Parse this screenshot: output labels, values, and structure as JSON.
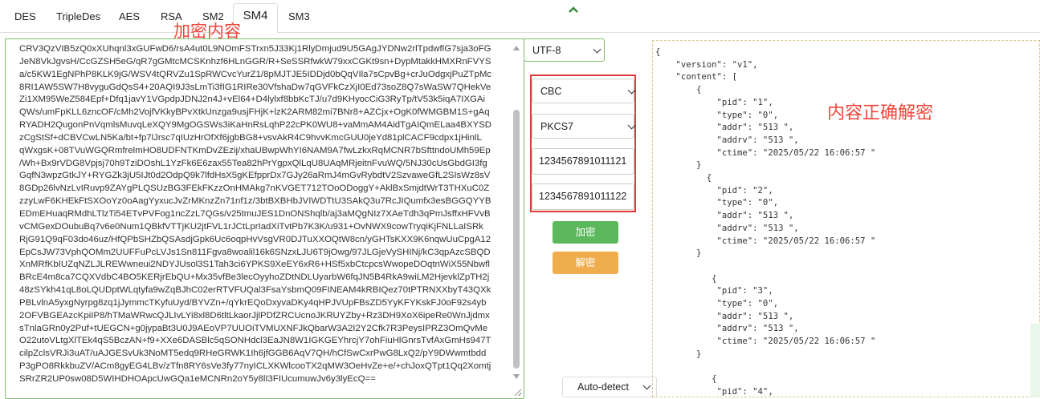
{
  "tabs": [
    {
      "label": "DES",
      "active": false
    },
    {
      "label": "TripleDes",
      "active": false
    },
    {
      "label": "AES",
      "active": false
    },
    {
      "label": "RSA",
      "active": false
    },
    {
      "label": "SM2",
      "active": false
    },
    {
      "label": "SM4",
      "active": true
    },
    {
      "label": "SM3",
      "active": false
    }
  ],
  "annotations": {
    "input_note": "加密内容",
    "output_note": "内容正确解密",
    "color": "#f2463a"
  },
  "ciphertext": [
    "CRV3QzVIB5zQ0xXUhqnl3xGUFwD6/rsA4ut0L9NOmFSTrxn5J33Kj1RlyDmjud9U5GAgJYDNw2rlTpdwflG7sja3oFG",
    "JeN8VkJgvsH/CcGZSH5eG/qR7gGMtcMCSKnhzf6HLnGGR/R+SeSSRfwkW79xxCGKt9sn+DypMtakkHMXRnFVYS",
    "a/c5KW1EgNPhP8KLK9jG/WSV4tQRVZu1SpRWCvcYurZ1/8pMJTJE5IDDjd0bQqVIla7sCpvBg+crJuOdgxjPuZTpMc",
    "8RI1AW5SW7H8vyguGdQsS4+20AQI9J3sLmTi3fIG1RIRe30VfshaDw7qGVFkCzXjI0Ed73soZ8Q7sWaSW7QHekVe",
    "Zi1XM95WeZ584Epf+Dfq1javY1VGpdpJDNJ2n4J+vEl64+D4lylxf8bbKcTJ/u7d9KHyocCiG3RyTp/tV53k5iqA7IXGAi",
    "QWs/umFpKLL6zncOF/cMh2VojfVKkyBPvXtkUnzga9usjFHjK+lzK2ARM82mi7BNr8+AZCjx+OgK0fWMGBM1S+gAq",
    "RYADH2QugonPnVqmlsMuvqLeXQY9MgOGSWs3iKaHnRsLqhP22cPK0WU8+vaMmAM4AidTgAIQmELaa4BXYSD",
    "zCgStSf+dCBVCwLN5Ka/bt+fp7lJrsc7qIUzHrOfXf6jgbBG8+vsvAkR4C9hvvKmcGUU0jeYd81plCACF9cdpx1jHinlL",
    "qWxgsK+08TVuWGQRmfrelmHO8UDFNTKmDvZEzij/xhaUBwpWhYI6NAM9A7fwLzkxRqMCNR7bSfttndoUMh59Ep",
    "/Wh+Bx9rVDG8Vpjsj70h9TziDOshL1YzFk6E6zax55Tea82hPrYgpxQlLqU8UAqMRjeitnFvuWQ/5NJ30cUsGbdGI3fg",
    "GqfN3wpzGtkJY+RYGZk3jU5IJt0d2OdpQ9k7lfdHsX5gKEfpprDx7GJy26aRmJ4mGvRybdtV2SzvaweGfL2SIsWz8sV",
    "8GDp26lvNzLvIRuvp9ZAYgPLQSUzBG3FEkFKzzOnHMAkg7nKVGET712TOoODoggY+AklBxSmjdtWrT3THXuC0Z",
    "zzyLwF6KHEkFtSXOoYz0oAagYyxucJvZrMKnzZn71nf1z/3btBXBHbJVIWDTtU3SAkQ3u7RcJIQumfx3esBGGQYYB",
    "EDmEHuaqRMdhLTlzTi54ETvPVFog1ncZzL7QGs/v25tmuJES1DnONShqlb/aj3aMQgNIz7XAeTdh3qPmJsffxHFVvB",
    "vCMGexDOubuBq7v6e0Num1QBkfVTTjKU2jtFVL1rJCtLprIadXiTvtPb7K3K/u931+OvNWX9cowTryqiKjFNLLaISRk",
    "RjG91Q9qF03do46uz/HfQPbSHZbQSAsdjGpk6Uc6oqpHvVsgVR0DJTuXXOQtW8cn/yGHTsKXX9K6nqwUuCpgA12",
    "EpCsJW73VphQOMm2UUFFuPcLVJs1Sn811Fgva8woalil16k6SNzxLJU6T9jOwg/97JLGjeVySHINj/kC3qpAzcSBQD",
    "XnMRfKbIUZqNZLJLREWwneui2NDYJUsol3S1Tah3ci6YPKS9XeEY6xR6+HSf5xbCtcpcsWwopeDOqtnWiX55Nbwfl",
    "BRcE4m8ca7CQXVdbC4BO5KERjrEbQU+Mx35vfBe3lecOyyhoZDtNDLUyarbW6fqJN5B4RkA9wiLM2HjevklZpTH2j",
    "48zSYkh41qL8oLQUDptWLqtyfa9wZqBJhC02erRTVFUQal3FsaYsbmQ09FINEAM4kRBIQez70tPTRNXXbyT43QXk",
    "PBLvlnA5yxgNyrpg8zq1jJymmcTKyfuUyd/BYVZn+/qYkrEQoDxyvaDKy4qHPJVUpFBsZD5YyKFYKskFJ0oF92s4yb",
    "2OFVBGEAzcKpiIP8/hTMaWRwcQJLIvLYi8xl8D6tltLkaorJjlPDfZRCUcnoJKRUYZby+Rz3DH9XoX6ipeRe0WnJjdmx",
    "sTnlaGRn0y2Puf+tUEGCN+g0jypaBt3U0J9AEoVP7UUOiTVMUXNFJkQbarW3A2I2Y2Cfk7R3PeysIPRZ3OmQvMe",
    "O22utoVLtgXlTEk4qS5BczAN+f9+XXe6DASBlc5qSONHdcl3EaJN8W1IGKGEYhrcjY7ohFiuHlGnrsTvfAxGmHs947T",
    "cilpZclsVRJi3uAT/uAJGESvUk3NoMT5edq9RHeGRWK1Ih6jfGGB6AqV7QH/hCfSwCxrPwG8LxQ2/pY9DWwmtbdd",
    "P3gPO8RkkbuZV/ACm8gyEG4LBv/zTfn8RY6sVe3fy77nyICLXKWlcooTX2qMW3OeHvZe+e/+chJoxQTpt1Qq2Xomtj",
    "SRrZR2UP0sw08D5WIHDHOApcUwGQa1eMCNRn2oY5y8lI3FIUcumuwJv6y3lyEcQ=="
  ],
  "encoding": {
    "selected": "UTF-8"
  },
  "mode": {
    "selected": "CBC"
  },
  "padding": {
    "selected": "PKCS7"
  },
  "key": {
    "value": "1234567891011121"
  },
  "iv": {
    "value": "1234567891011122"
  },
  "buttons": {
    "encrypt": "加密",
    "decrypt": "解密"
  },
  "detect": {
    "selected": "Auto-detect"
  },
  "output_lines": [
    "{",
    "    \"version\": \"v1\",",
    "    \"content\": [",
    "        {",
    "            \"pid\": \"1\",",
    "            \"type\": \"0\",",
    "            \"addr\": \"513 \",",
    "            \"addrv\": \"513 \",",
    "            \"ctime\": \"2025/05/22 16:06:57 \"",
    "        }",
    "          {",
    "            \"pid\": \"2\",",
    "            \"type\": \"0\",",
    "            \"addr\": \"513 \",",
    "            \"addrv\": \"513 \",",
    "            \"ctime\": \"2025/05/22 16:06:57 \"",
    "        }",
    "",
    "           {",
    "            \"pid\": \"3\",",
    "            \"type\": \"0\",",
    "            \"addr\": \"513 \",",
    "            \"addrv\": \"513 \",",
    "            \"ctime\": \"2025/05/22 16:06:57 \"",
    "        }",
    "",
    "           {",
    "            \"pid\": \"4\","
  ]
}
